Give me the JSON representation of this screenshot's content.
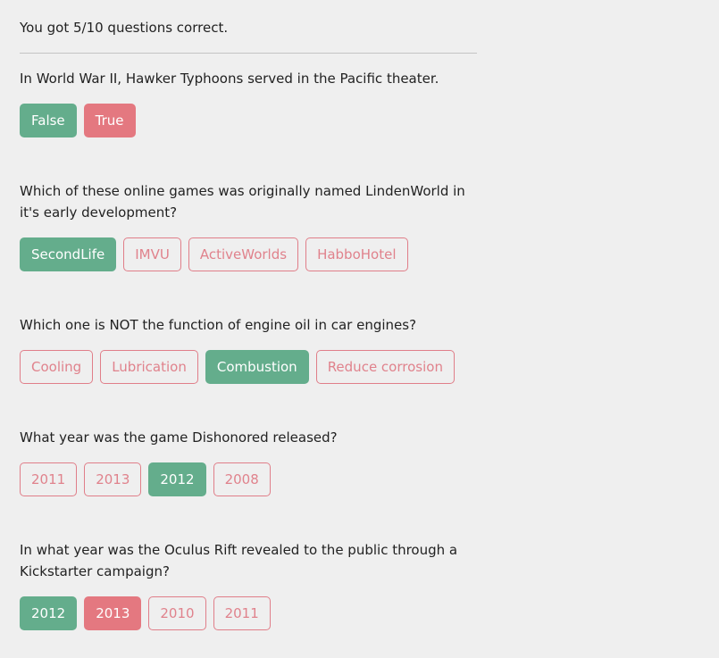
{
  "result": {
    "score_text": "You got 5/10 questions correct."
  },
  "colors": {
    "correct": "#64ad8c",
    "wrong_selected": "#e47880",
    "unselected_outline": "#e07e89",
    "background": "#efefef"
  },
  "questions": [
    {
      "text": "In World War II, Hawker Typhoons served in the Pacific theater.",
      "answers": [
        {
          "label": "False",
          "state": "correct"
        },
        {
          "label": "True",
          "state": "wrong"
        }
      ]
    },
    {
      "text": "Which of these online games was originally named LindenWorld in it's early development?",
      "answers": [
        {
          "label": "SecondLife",
          "state": "correct"
        },
        {
          "label": "IMVU",
          "state": "default"
        },
        {
          "label": "ActiveWorlds",
          "state": "default"
        },
        {
          "label": "HabboHotel",
          "state": "default"
        }
      ]
    },
    {
      "text": "Which one is NOT the function of engine oil in car engines?",
      "answers": [
        {
          "label": "Cooling",
          "state": "default"
        },
        {
          "label": "Lubrication",
          "state": "default"
        },
        {
          "label": "Combustion",
          "state": "correct"
        },
        {
          "label": "Reduce corrosion",
          "state": "default"
        }
      ]
    },
    {
      "text": "What year was the game Dishonored released?",
      "answers": [
        {
          "label": "2011",
          "state": "default"
        },
        {
          "label": "2013",
          "state": "default"
        },
        {
          "label": "2012",
          "state": "correct"
        },
        {
          "label": "2008",
          "state": "default"
        }
      ]
    },
    {
      "text": "In what year was the Oculus Rift revealed to the public through a Kickstarter campaign?",
      "answers": [
        {
          "label": "2012",
          "state": "correct"
        },
        {
          "label": "2013",
          "state": "wrong"
        },
        {
          "label": "2010",
          "state": "default"
        },
        {
          "label": "2011",
          "state": "default"
        }
      ]
    }
  ]
}
